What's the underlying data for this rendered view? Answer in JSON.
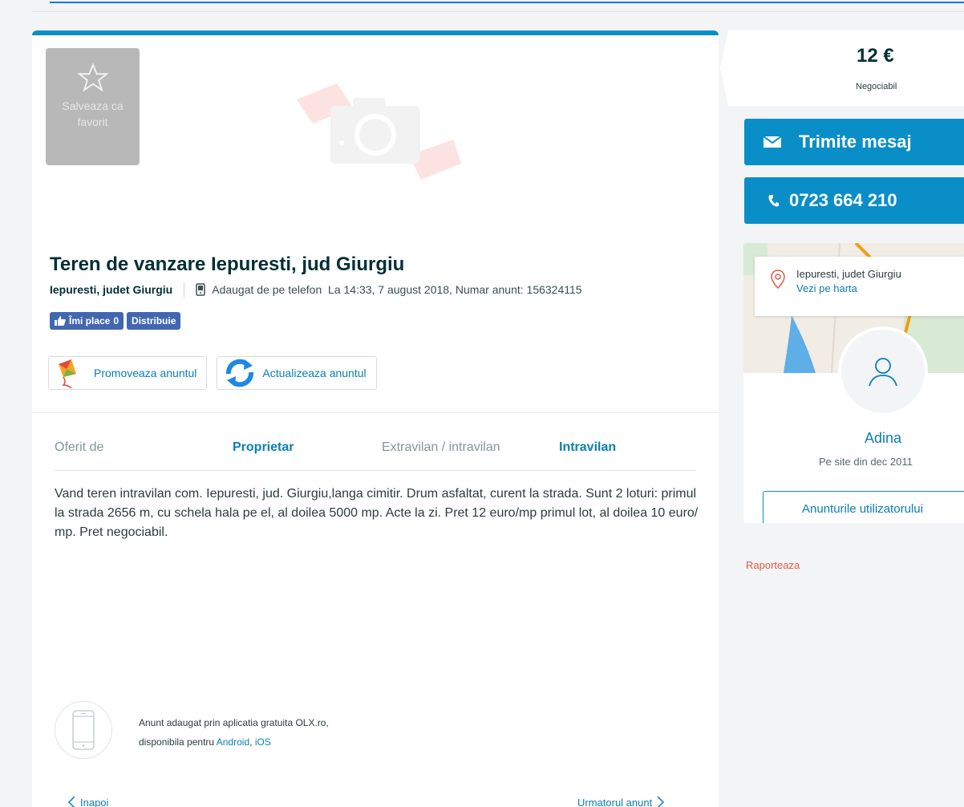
{
  "favorite": {
    "label": "Salveaza ca favorit"
  },
  "ad": {
    "title": "Teren de vanzare Iepuresti, jud Giurgiu",
    "location": "Iepuresti, judet Giurgiu",
    "added_from": "Adaugat de pe telefon",
    "date_and_id": "La 14:33, 7 august 2018, Numar anunt: 156324115",
    "description": "Vand teren intravilan com. Iepuresti, jud. Giurgiu,langa cimitir. Drum asfaltat, curent la strada. Sunt 2 loturi: primul la strada 2656 m, cu schela hala pe el, al doilea 5000 mp. Acte la zi. Pret 12 euro/mp primul lot, al doilea 10 euro/ mp. Pret negociabil."
  },
  "facebook": {
    "like_label": "Îmi place",
    "like_count": "0",
    "share_label": "Distribuie"
  },
  "actions": {
    "promote": "Promoveaza anuntul",
    "refresh": "Actualizeaza anuntul"
  },
  "specs": [
    {
      "label": "Oferit de",
      "value": "Proprietar"
    },
    {
      "label": "Extravilan / intravilan",
      "value": "Intravilan"
    }
  ],
  "app_promo": {
    "line1": "Anunt adaugat prin aplicatia gratuita OLX.ro,",
    "line2_prefix": "disponibila pentru",
    "android": "Android",
    "comma": ",",
    "ios": "iOS"
  },
  "nav": {
    "prev": "Inapoi",
    "next": "Urmatorul anunt"
  },
  "price": {
    "amount": "12 €",
    "note": "Negociabil"
  },
  "contact": {
    "message": "Trimite mesaj",
    "phone": "0723 664 210"
  },
  "seller": {
    "location": "Iepuresti, judet Giurgiu",
    "map_link": "Vezi pe harta",
    "name": "Adina",
    "since": "Pe site din dec 2011",
    "ads_button": "Anunturile utilizatorului"
  },
  "report": "Raporteaza",
  "colors": {
    "accent": "#0a8ec8",
    "link": "#0a7fb5",
    "facebook": "#4267b2",
    "report": "#e05b4b"
  }
}
